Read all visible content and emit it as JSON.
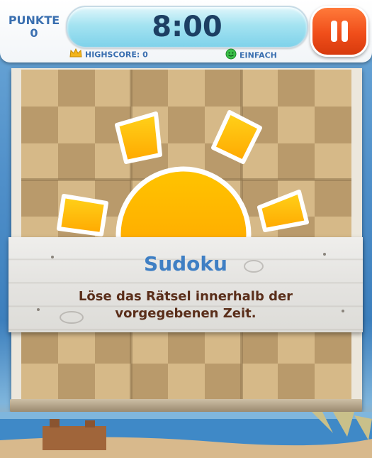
{
  "score": {
    "label": "PUNKTE",
    "value": "0"
  },
  "timer": {
    "value": "8:00"
  },
  "pause_button": {
    "icon": "pause-icon"
  },
  "highscore": {
    "label": "HIGHSCORE: 0",
    "icon": "crown-icon"
  },
  "difficulty": {
    "label": "EINFACH",
    "icon": "smiley-icon"
  },
  "banner": {
    "title": "Sudoku",
    "text": "Löse das Rätsel innerhalb der vorgegebenen Zeit."
  },
  "colors": {
    "accent_blue": "#3f7fc4",
    "pause_orange": "#f04e1a",
    "timer_cyan": "#a4e3f1",
    "text_brown": "#5a2e1a",
    "sun_yellow": "#ffb400"
  }
}
